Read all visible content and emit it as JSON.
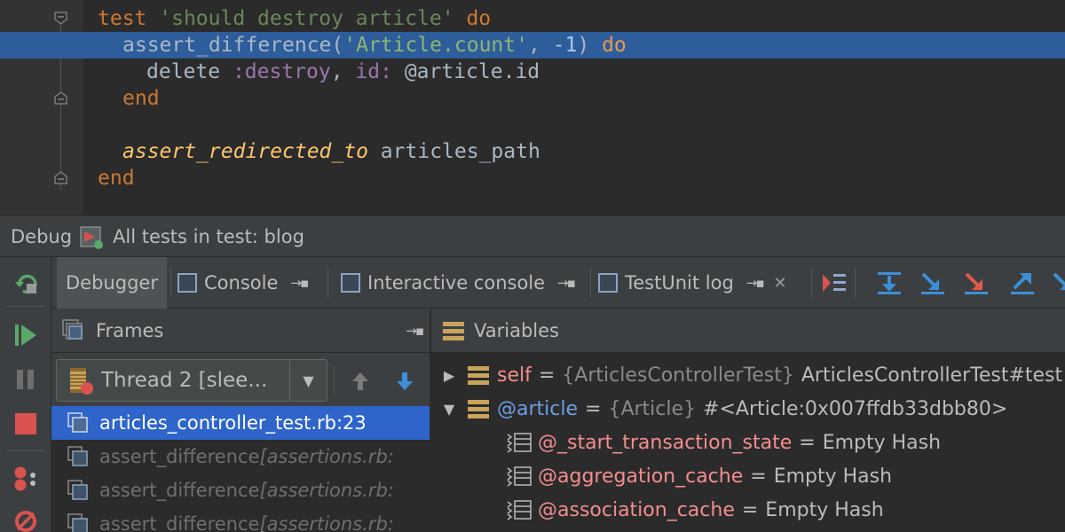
{
  "editor": {
    "lines": [
      [
        {
          "t": "kw",
          "v": "test"
        },
        {
          "t": "plain",
          "v": " "
        },
        {
          "t": "str",
          "v": "'should destroy article'"
        },
        {
          "t": "plain",
          "v": " "
        },
        {
          "t": "kw",
          "v": "do"
        }
      ],
      [
        {
          "t": "plain",
          "v": "assert_difference("
        },
        {
          "t": "str",
          "v": "'Article.count'"
        },
        {
          "t": "plain",
          "v": ", "
        },
        {
          "t": "num",
          "v": "-1"
        },
        {
          "t": "plain",
          "v": ") "
        },
        {
          "t": "kw",
          "v": "do"
        }
      ],
      [
        {
          "t": "plain",
          "v": "delete "
        },
        {
          "t": "sym",
          "v": ":destroy"
        },
        {
          "t": "plain",
          "v": ", "
        },
        {
          "t": "sym",
          "v": "id:"
        },
        {
          "t": "plain",
          "v": " @article.id"
        }
      ],
      [
        {
          "t": "kw",
          "v": "end"
        }
      ],
      [],
      [
        {
          "t": "fn",
          "v": "assert_redirected_to"
        },
        {
          "t": "plain",
          "v": " articles_path"
        }
      ],
      [
        {
          "t": "kw",
          "v": "end"
        }
      ]
    ]
  },
  "debug_bar": {
    "label": "Debug",
    "config_name": "All tests in test: blog"
  },
  "tabs": {
    "debugger": "Debugger",
    "console": "Console",
    "interactive_console": "Interactive console",
    "testunit_log": "TestUnit log",
    "pin_glyph": "→▪",
    "close_glyph": "✕"
  },
  "frames": {
    "title": "Frames",
    "thread": "Thread 2 [slee...",
    "rows": [
      {
        "method": "articles_controller_test.rb:23",
        "loc": ""
      },
      {
        "method": "assert_difference ",
        "loc": "[assertions.rb:"
      },
      {
        "method": "assert_difference ",
        "loc": "[assertions.rb:"
      },
      {
        "method": "assert_difference ",
        "loc": "[assertions.rb:"
      }
    ]
  },
  "variables": {
    "title": "Variables",
    "rows": [
      {
        "name": "self",
        "type": "{ArticlesControllerTest}",
        "value": "ArticlesControllerTest#test"
      },
      {
        "name": "@article",
        "type": "{Article}",
        "value": "#<Article:0x007ffdb33dbb80>"
      },
      {
        "name": "@_start_transaction_state",
        "type": "",
        "value": "Empty Hash"
      },
      {
        "name": "@aggregation_cache",
        "type": "",
        "value": "Empty Hash"
      },
      {
        "name": "@association_cache",
        "type": "",
        "value": "Empty Hash"
      }
    ]
  },
  "colors": {
    "editor_bg": "#2b2b2b",
    "current_line": "#2d5d9a",
    "selection": "#2f65ca",
    "breakpoint": "#d93b3b",
    "keyword": "#cc7832",
    "string": "#6a8759"
  }
}
